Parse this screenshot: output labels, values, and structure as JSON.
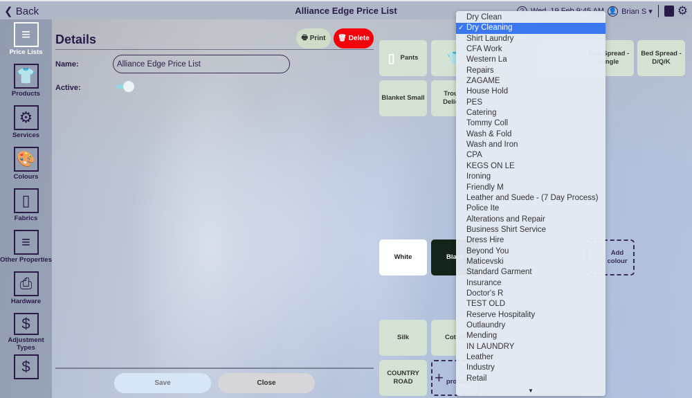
{
  "topbar": {
    "back_label": "Back",
    "title": "Alliance Edge Price List",
    "help_icon": "?",
    "datetime": "Wed, 19 Feb 9:45 AM",
    "user": "Brian S"
  },
  "sidebar": {
    "items": [
      {
        "label": "Price Lists",
        "icon": "≡",
        "active": true
      },
      {
        "label": "Products",
        "icon": "👕"
      },
      {
        "label": "Services",
        "icon": "⚙"
      },
      {
        "label": "Colours",
        "icon": "🎨"
      },
      {
        "label": "Fabrics",
        "icon": "▯"
      },
      {
        "label": "Other Properties",
        "icon": "≡"
      },
      {
        "label": "Hardware",
        "icon": "⎙"
      },
      {
        "label": "Adjustment Types",
        "icon": "$"
      },
      {
        "label": "",
        "icon": "$"
      }
    ]
  },
  "details": {
    "title": "Details",
    "print_label": "Print",
    "delete_label": "Delete",
    "name_label": "Name:",
    "name_value": "Alliance Edge Price List",
    "active_label": "Active:",
    "active": true,
    "save_label": "Save",
    "close_label": "Close"
  },
  "products": [
    "Pants",
    "",
    "Bed Spread - Single",
    "Bed Spread - D/Q/K",
    "Blanket Small",
    "Trou Delic"
  ],
  "colours": [
    "White",
    "Black",
    "Add colour"
  ],
  "fabrics": [
    "Silk",
    "Cotton",
    "COUNTRY ROAD",
    "product"
  ],
  "dropdown": {
    "selected": "Dry Cleaning",
    "options": [
      "Dry Clean",
      "Dry Cleaning",
      "Shirt Laundry",
      "CFA Work",
      "Western La",
      "Repairs",
      "ZAGAME",
      "House Hold",
      "PES",
      "Catering",
      "Tommy Coll",
      "Wash & Fold",
      "Wash and Iron",
      "CPA",
      "KEGS ON LE",
      "Ironing",
      "Friendly M",
      "Leather and Suede - (7 Day Process)",
      "Police Ite",
      "Alterations and Repair",
      "Business Shirt Service",
      "Dress Hire",
      "Beyond You",
      "Maticevski",
      "Standard Garment",
      "Insurance",
      "Doctor's R",
      "TEST OLD",
      "Reserve Hospitality",
      "Outlaundry",
      "Mending",
      "IN LAUNDRY",
      "Leather",
      "Industry",
      "Retail"
    ]
  }
}
